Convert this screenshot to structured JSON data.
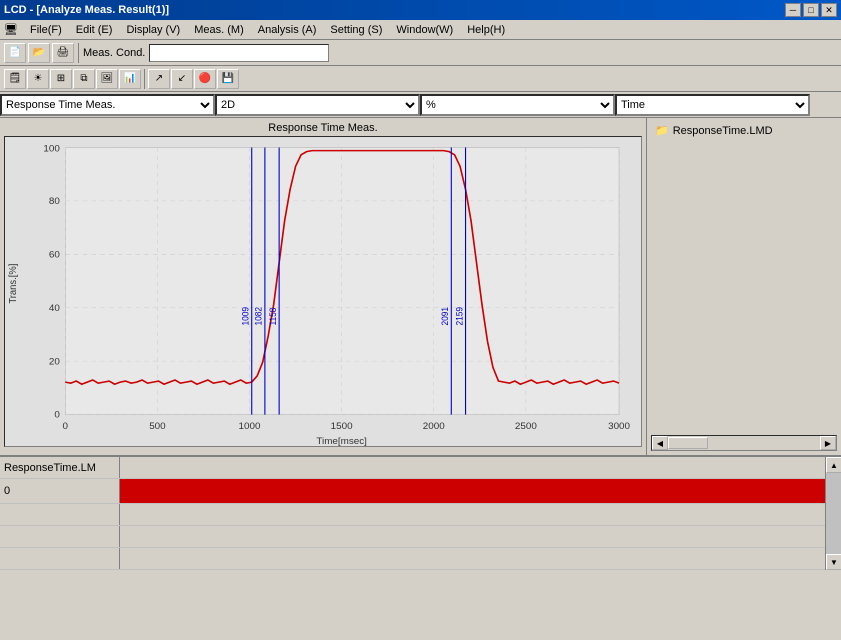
{
  "window": {
    "title": "LCD - [Analyze Meas. Result(1)]",
    "min_btn": "─",
    "max_btn": "□",
    "close_btn": "✕"
  },
  "menubar": {
    "items": [
      {
        "label": "File(F)"
      },
      {
        "label": "Edit (E)"
      },
      {
        "label": "Display (V)"
      },
      {
        "label": "Meas. (M)"
      },
      {
        "label": "Analysis (A)"
      },
      {
        "label": "Setting (S)"
      },
      {
        "label": "Window(W)"
      },
      {
        "label": "Help(H)"
      }
    ]
  },
  "toolbar": {
    "meas_cond_label": "Meas. Cond.",
    "meas_cond_value": ""
  },
  "dropdowns": {
    "measurement": "Response Time Meas.",
    "mode": "2D",
    "unit": "%",
    "axis": "Time"
  },
  "chart": {
    "title": "Response Time Meas.",
    "y_label": "Trans.[%]",
    "x_label": "Time[msec]",
    "y_ticks": [
      "0",
      "20",
      "40",
      "60",
      "80",
      "100"
    ],
    "x_ticks": [
      "0",
      "500",
      "1000",
      "1500",
      "2000",
      "2500",
      "3000"
    ],
    "marker_labels": [
      "1009",
      "1082",
      "1158",
      "2091",
      "2159"
    ],
    "accent_color": "#0000cc",
    "line_color": "#cc0000"
  },
  "right_panel": {
    "file_name": "ResponseTime.LMD",
    "file_icon": "📄"
  },
  "bottom_panel": {
    "header_label": "ResponseTime.LM",
    "rows": [
      {
        "label": "0",
        "has_bar": true
      },
      {
        "label": "",
        "has_bar": false
      },
      {
        "label": "",
        "has_bar": false
      },
      {
        "label": "",
        "has_bar": false
      }
    ]
  },
  "icons": {
    "open": "📂",
    "save": "💾",
    "print": "🖨",
    "chart": "📊",
    "grid": "▦",
    "camera": "📷",
    "sun": "☀",
    "table": "⊞",
    "layers": "⧉",
    "bar_chart": "📈",
    "export": "↗",
    "import": "↙",
    "red_circle": "🔴",
    "floppy": "💾",
    "folder_yellow": "📁"
  }
}
